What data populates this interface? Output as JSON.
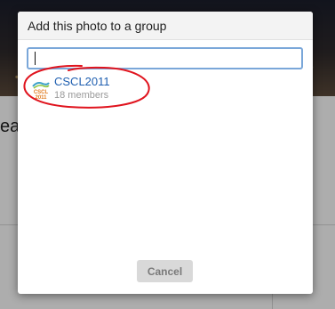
{
  "background": {
    "heading_fragment": "eal"
  },
  "dialog": {
    "title": "Add this photo to a group",
    "search": {
      "value": "",
      "placeholder": ""
    },
    "groups": [
      {
        "name": "CSCL2011",
        "members": "18 members",
        "logo_text": "CSCL 2011"
      }
    ],
    "cancel_label": "Cancel"
  },
  "colors": {
    "link_blue": "#1f5fb0",
    "focus_border": "#7aa7d9",
    "annotation_red": "#e0141e",
    "button_bg": "#d9d9d9"
  }
}
